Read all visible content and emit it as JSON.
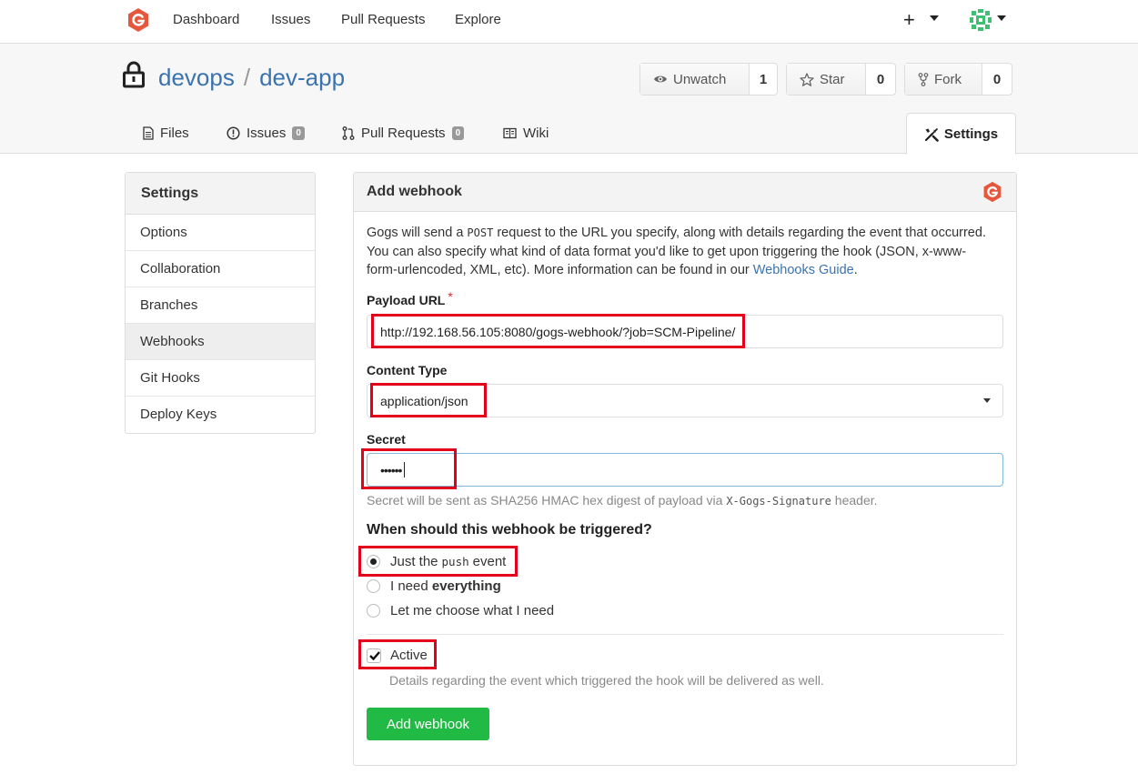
{
  "nav": {
    "links": [
      "Dashboard",
      "Issues",
      "Pull Requests",
      "Explore"
    ],
    "plus": "+"
  },
  "repo": {
    "owner": "devops",
    "separator": "/",
    "name": "dev-app",
    "unwatch_label": "Unwatch",
    "watch_count": "1",
    "star_label": "Star",
    "star_count": "0",
    "fork_label": "Fork",
    "fork_count": "0"
  },
  "tabs": {
    "files": "Files",
    "issues": "Issues",
    "issues_count": "0",
    "pulls": "Pull Requests",
    "pulls_count": "0",
    "wiki": "Wiki",
    "settings": "Settings"
  },
  "sidebar": {
    "title": "Settings",
    "items": [
      "Options",
      "Collaboration",
      "Branches",
      "Webhooks",
      "Git Hooks",
      "Deploy Keys"
    ],
    "active": "Webhooks"
  },
  "panel": {
    "title": "Add webhook",
    "desc_1": "Gogs will send a ",
    "desc_code": "POST",
    "desc_2": " request to the URL you specify, along with details regarding the event that occurred. You can also specify what kind of data format you'd like to get upon triggering the hook (JSON, x-www-form-urlencoded, XML, etc). More information can be found in our ",
    "desc_link": "Webhooks Guide",
    "desc_3": ".",
    "payload_label": "Payload URL",
    "required_mark": "*",
    "payload_value": "http://192.168.56.105:8080/gogs-webhook/?job=SCM-Pipeline/",
    "content_type_label": "Content Type",
    "content_type_value": "application/json",
    "secret_label": "Secret",
    "secret_value": "••••••",
    "secret_hint_1": "Secret will be sent as SHA256 HMAC hex digest of payload via ",
    "secret_hint_code": "X-Gogs-Signature",
    "secret_hint_2": " header.",
    "trigger_question": "When should this webhook be triggered?",
    "opt_push_1": "Just the",
    "opt_push_code": "push",
    "opt_push_2": "event",
    "opt_all_1": "I need ",
    "opt_all_2": "everything",
    "opt_choose": "Let me choose what I need",
    "active_label": "Active",
    "active_hint": "Details regarding the event which triggered the hook will be delivered as well.",
    "submit_label": "Add webhook"
  },
  "colors": {
    "link": "#3b73af",
    "primary_button": "#21ba45",
    "annotation": "#e2001a",
    "gogs_logo": "#e5583e"
  }
}
